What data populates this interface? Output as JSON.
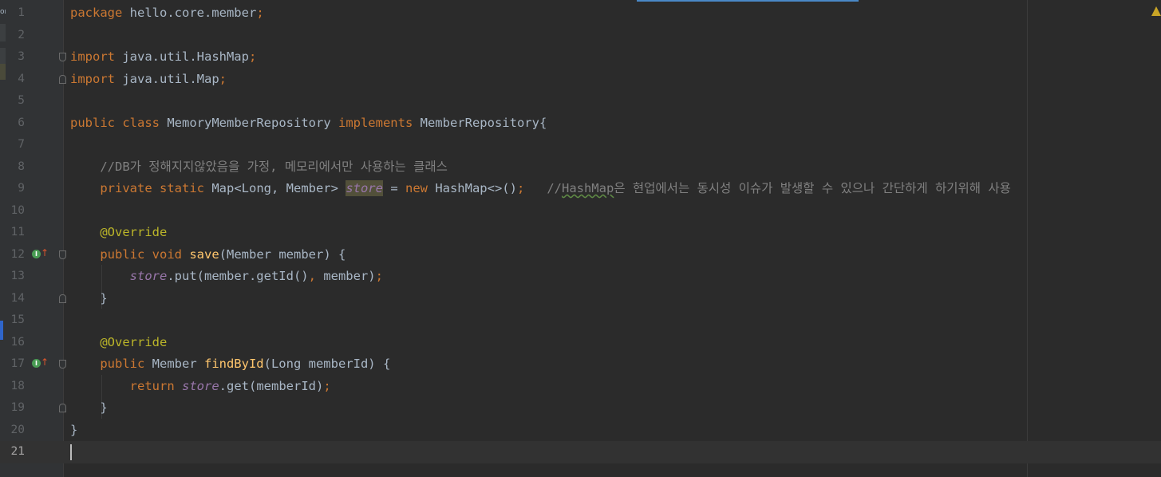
{
  "editor": {
    "file_package": "package hello.core.member;",
    "line_numbers": [
      "1",
      "2",
      "3",
      "4",
      "5",
      "6",
      "7",
      "8",
      "9",
      "10",
      "11",
      "12",
      "13",
      "14",
      "15",
      "16",
      "17",
      "18",
      "19",
      "20",
      "21"
    ],
    "current_line": "21",
    "side_label": "or",
    "tokens": {
      "package": "package",
      "package_name": " hello.core.member",
      "semicolon": ";",
      "import": "import",
      "import1": " java.util.HashMap",
      "import2": " java.util.Map",
      "public": "public",
      "class": "class",
      "class_name": " MemoryMemberRepository ",
      "implements": "implements",
      "interface_name": " MemberRepository{",
      "comment_db": "//DB가 정해지지않았음을 가정, 메모리에서만 사용하는 클래스",
      "private": "private",
      "static": "static",
      "map_type": " Map<Long, Member> ",
      "store": "store",
      "assign": " = ",
      "new": "new",
      "hashmap_ctor": " HashMap<>()",
      "comment_hashmap_prefix": "//",
      "comment_hashmap_word": "HashMap",
      "comment_hashmap_rest": "은 현업에서는 동시성 이슈가 발생할 수 있으나 간단하게 하기위해 사용",
      "override": "@Override",
      "void": "void",
      "save": "save",
      "save_params": "(Member member) {",
      "put_call": ".put(member.getId()",
      "comma": ",",
      "put_end": " member)",
      "close_brace": "}",
      "member_type": " Member ",
      "findById": "findById",
      "find_params": "(Long memberId) {",
      "return": "return",
      "get_call": ".get(memberId)"
    }
  },
  "colors": {
    "background": "#2b2b2b",
    "keyword": "#cc7832",
    "annotation": "#bbb529",
    "field": "#9876aa",
    "method": "#ffc66d",
    "comment": "#808080",
    "text": "#a9b7c6"
  },
  "icons": {
    "implements_gutter": "implementing-method-icon",
    "fold": "fold-marker-icon",
    "warning": "warning-icon"
  }
}
